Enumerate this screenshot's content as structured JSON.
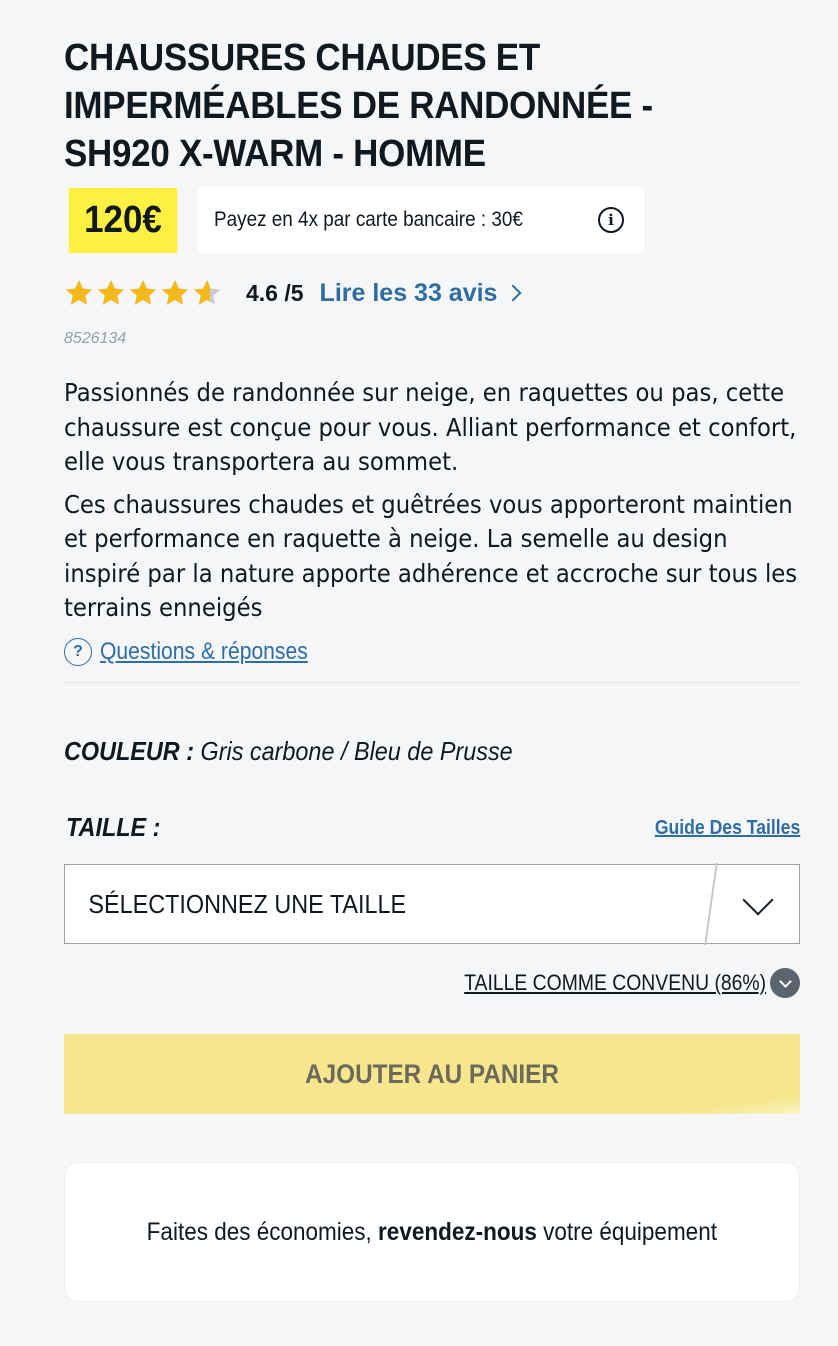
{
  "product": {
    "title": "CHAUSSURES CHAUDES ET IMPERMÉABLES DE RANDONNÉE - SH920 X-WARM - HOMME",
    "price": "120€",
    "installment_text": "Payez en 4x par carte bancaire : 30€",
    "rating_value": 4.6,
    "rating_text": "4.6 /5",
    "reviews_link": "Lire les 33 avis",
    "sku": "8526134",
    "description": [
      "Passionnés de randonnée sur neige, en raquettes ou pas, cette chaussure est conçue pour vous. Alliant performance et confort, elle vous transportera au sommet.",
      "Ces chaussures chaudes et guêtrées vous apporteront maintien et performance en raquette à neige. La semelle au design inspiré par la nature apporte adhérence et accroche sur tous les terrains enneigés"
    ],
    "qa_link": "Questions & réponses"
  },
  "color": {
    "label": "COULEUR :",
    "value": "Gris carbone / Bleu de Prusse"
  },
  "size": {
    "label": "TAILLE :",
    "guide_link": "Guide Des Tailles",
    "select_value": "SÉLECTIONNEZ UNE TAILLE",
    "fit_text": "TAILLE COMME CONVENU (86%)"
  },
  "cart": {
    "add_label": "AJOUTER AU PANIER"
  },
  "resell": {
    "prefix": "Faites des économies,",
    "bold": "revendez-nous",
    "suffix": "votre équipement"
  },
  "icons": {
    "info": "info-icon",
    "star": "star-icon",
    "chevron_right": "chevron-right-icon",
    "question": "question-icon",
    "chevron_down": "chevron-down-icon"
  },
  "colors": {
    "price_bg": "#fff142",
    "link": "#2e6da4",
    "star": "#f5b91e",
    "star_empty": "#c9ccd0",
    "add_cart_bg": "#f6e68d",
    "page_bg": "#f5f6f8"
  }
}
